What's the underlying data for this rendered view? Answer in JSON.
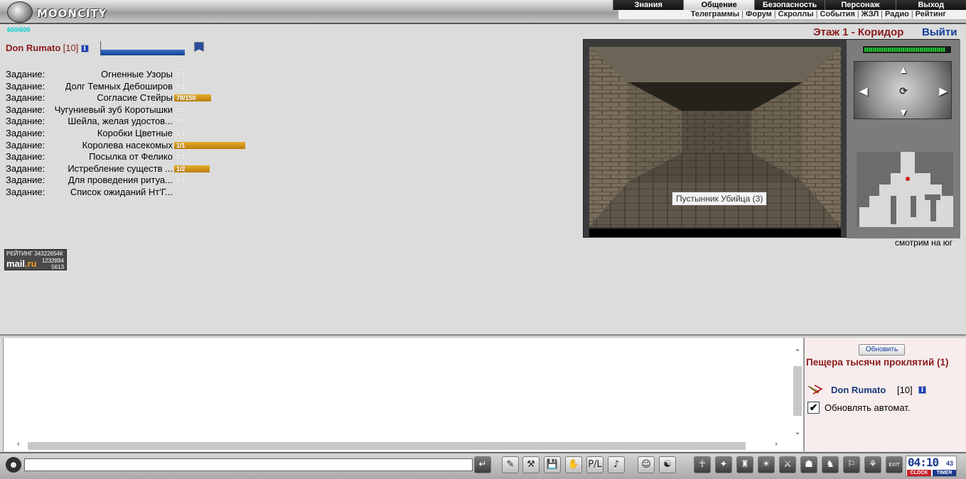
{
  "header": {
    "logo_text": "MOONCITY",
    "main_menu": [
      "Знания",
      "Общение",
      "Безопасность",
      "Персонаж",
      "Выход"
    ],
    "active_menu": "Общение",
    "sub_menu": [
      "Телеграммы",
      "Форум",
      "Скроллы",
      "События",
      "ЖЗЛ",
      "Радио",
      "Рейтинг"
    ]
  },
  "character": {
    "hp_text": "600/600",
    "name": "Don Rumato",
    "level": "[10]",
    "info_icon": "i",
    "exp_value": "0/1",
    "exp_fraction": 0.98
  },
  "quests": [
    {
      "label": "Задание:",
      "name": "Огненные Узоры",
      "progress": "0/1",
      "fraction": 0
    },
    {
      "label": "Задание:",
      "name": "Долг Темных Дебоширов",
      "progress": "0/1",
      "fraction": 0
    },
    {
      "label": "Задание:",
      "name": "Согласие Стейры",
      "progress": "78/150",
      "fraction": 0.52
    },
    {
      "label": "Задание:",
      "name": "Чугуниевый зуб Коротышки",
      "progress": "0/5",
      "fraction": 0
    },
    {
      "label": "Задание:",
      "name": "Шейла, желая удостов...",
      "progress": "0/5",
      "fraction": 0
    },
    {
      "label": "Задание:",
      "name": "Коробки Цветные",
      "progress": "0/1",
      "fraction": 0
    },
    {
      "label": "Задание:",
      "name": "Королева насекомых",
      "progress": "1/1",
      "fraction": 1
    },
    {
      "label": "Задание:",
      "name": "Посылка от Фелико",
      "progress": "0/1",
      "fraction": 0
    },
    {
      "label": "Задание:",
      "name": "Истребление существ ...",
      "progress": "1/2",
      "fraction": 0.5
    },
    {
      "label": "Задание:",
      "name": "Для проведения ритуа...",
      "progress": "0/1",
      "fraction": 0
    },
    {
      "label": "Задание:",
      "name": "Список ожиданий Нт'Г...",
      "progress": "",
      "fraction": 0
    }
  ],
  "rating_badge": {
    "top": "РЕЙТИНГ 34322654К",
    "logo_a": "mail",
    "logo_b": ".ru",
    "num1": "1232894",
    "num2": "5613"
  },
  "location": {
    "title": "Этаж 1 - Коридор",
    "exit": "Выйти",
    "monster": "Пустынник Убийца (3)",
    "facing": "смотрим на юг",
    "hp_fraction": 0.95
  },
  "right_panel": {
    "refresh": "Обновить",
    "room": "Пещера тысячи проклятий (1)",
    "player_name": "Don Rumato",
    "player_level": "[10]",
    "auto_update": "Обновлять автомат.",
    "auto_checked": "✔"
  },
  "toolbar": {
    "input_value": "",
    "buttons_left": [
      "↵",
      "✎",
      "⚒",
      "💾",
      "✋",
      "P/L",
      "♪",
      "☺",
      "☯"
    ],
    "buttons_right": [
      "☥",
      "✦",
      "♜",
      "☀",
      "⚔",
      "☗",
      "♞",
      "⚐",
      "⚘",
      "EXIT"
    ],
    "clock_time": "04:10",
    "clock_sec": "43",
    "clock_label": "CLOCK",
    "timer_label": "TIMER"
  }
}
